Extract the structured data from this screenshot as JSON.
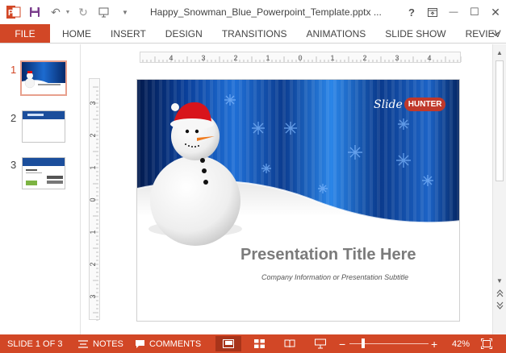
{
  "window": {
    "title": "Happy_Snowman_Blue_Powerpoint_Template.pptx - PowerPoint",
    "title_display": "Happy_Snowman_Blue_Powerpoint_Template.pptx ...",
    "help": "?",
    "restore_ribbon": "⇱",
    "minimize": "—",
    "maximize": "☐"
  },
  "ribbon": {
    "file": "FILE",
    "tabs": [
      "HOME",
      "INSERT",
      "DESIGN",
      "TRANSITIONS",
      "ANIMATIONS",
      "SLIDE SHOW",
      "REVIEW"
    ],
    "tab_last_visible": "REVIEV"
  },
  "thumbnails": [
    {
      "number": "1",
      "active": true
    },
    {
      "number": "2",
      "active": false
    },
    {
      "number": "3",
      "active": false
    }
  ],
  "ruler": {
    "horizontal": [
      "4",
      "3",
      "2",
      "1",
      "0",
      "1",
      "2",
      "3",
      "4"
    ],
    "vertical": [
      "3",
      "2",
      "1",
      "0",
      "1",
      "2",
      "3"
    ]
  },
  "slide": {
    "title": "Presentation Title Here",
    "subtitle": "Company Information or Presentation Subtitle",
    "brand_slide": "Slide",
    "brand_hunter": "HUNTER"
  },
  "status": {
    "slide_info": "SLIDE 1 OF 3",
    "notes": "NOTES",
    "comments": "COMMENTS",
    "zoom": "42%",
    "zoom_minus": "−",
    "zoom_plus": "+",
    "zoom_level": 0.42
  },
  "colors": {
    "accent": "#d24726",
    "slide_blue": "#0d3d8c"
  },
  "icons": [
    "powerpoint-logo-icon",
    "save-icon",
    "undo-icon",
    "redo-icon",
    "start-from-beginning-icon",
    "customize-qat-icon",
    "notes-icon",
    "comments-icon",
    "normal-view-icon",
    "slide-sorter-icon",
    "reading-view-icon",
    "slide-show-icon",
    "fit-to-window-icon"
  ]
}
